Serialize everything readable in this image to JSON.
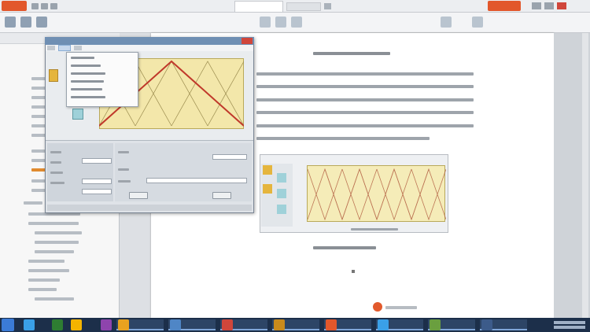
{
  "colors": {
    "accent": "#e2572b",
    "dialog_title": "#6f8fb3",
    "plot_fill": "#f3e7aa",
    "curve_red": "#c0392b",
    "taskbar": "#1c2f4a"
  },
  "icons": {
    "app_menu": "app-menu-icon",
    "close": "close-icon",
    "minimize": "minimize-icon",
    "maximize": "maximize-icon",
    "start": "start-icon"
  }
}
